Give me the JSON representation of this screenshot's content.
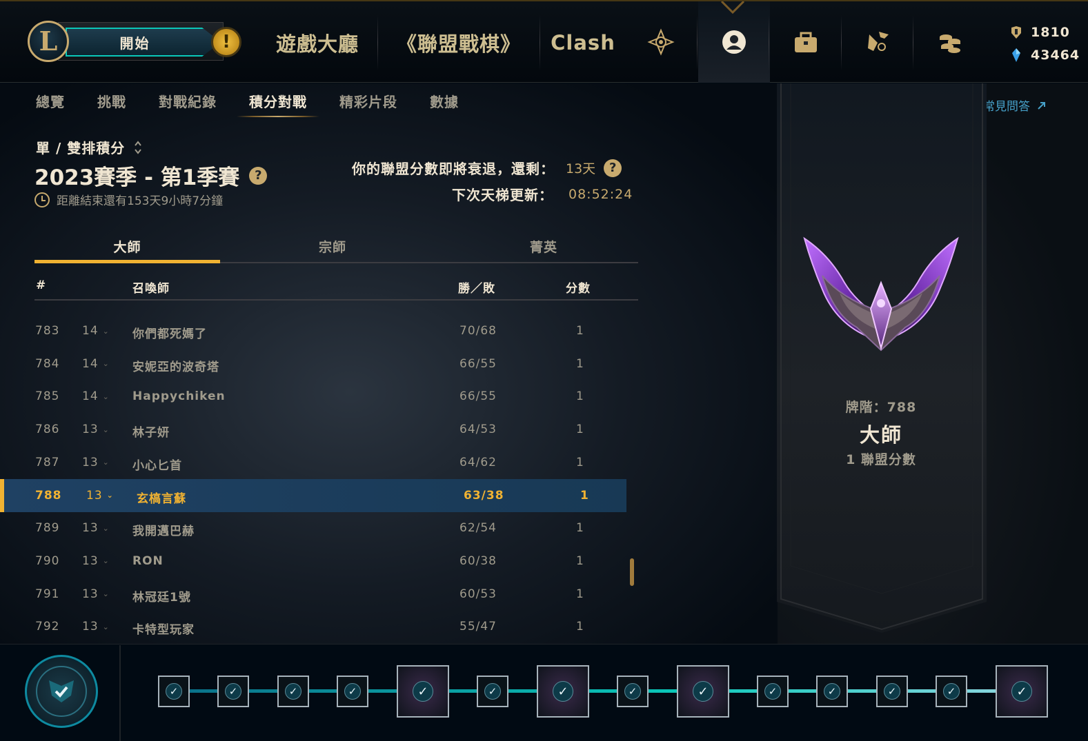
{
  "header": {
    "play_label": "開始",
    "nav_items": [
      "遊戲大廳",
      "《聯盟戰棋》",
      "Clash"
    ],
    "icons": [
      "trophy-icon",
      "profile-icon",
      "collection-icon",
      "loot-icon",
      "store-icon"
    ],
    "currency": {
      "rp": "1810",
      "be": "43464"
    }
  },
  "subnav": {
    "tabs": [
      "總覽",
      "挑戰",
      "對戰紀錄",
      "積分對戰",
      "精彩片段",
      "數據"
    ],
    "active": "積分對戰",
    "faq_link": "聯盟系統常見問答"
  },
  "ranked": {
    "queue": "單 / 雙排積分",
    "season_title": "2023賽季 - 第1季賽",
    "season_end": "距離結束還有153天9小時7分鐘",
    "decay_label": "你的聯盟分數即將衰退，還剩：",
    "decay_value": "13天",
    "ladder_label": "下次天梯更新：",
    "ladder_value": "08:52:24"
  },
  "tier_tabs": [
    "大師",
    "宗師",
    "菁英"
  ],
  "table": {
    "headers": {
      "rank": "#",
      "summoner": "召喚師",
      "winloss": "勝／敗",
      "points": "分數"
    },
    "rows": [
      {
        "rank": "783",
        "level": "14",
        "name": "你們都死媽了",
        "wl": "70/68",
        "lp": "1"
      },
      {
        "rank": "784",
        "level": "14",
        "name": "安妮亞的波奇塔",
        "wl": "66/55",
        "lp": "1"
      },
      {
        "rank": "785",
        "level": "14",
        "name": "Happychiken",
        "wl": "66/55",
        "lp": "1"
      },
      {
        "rank": "786",
        "level": "13",
        "name": "林子妍",
        "wl": "64/53",
        "lp": "1"
      },
      {
        "rank": "787",
        "level": "13",
        "name": "小心匕首",
        "wl": "64/62",
        "lp": "1"
      },
      {
        "rank": "788",
        "level": "13",
        "name": "玄槁言蘇",
        "wl": "63/38",
        "lp": "1"
      },
      {
        "rank": "789",
        "level": "13",
        "name": "我開邁巴赫",
        "wl": "62/54",
        "lp": "1"
      },
      {
        "rank": "790",
        "level": "13",
        "name": "RON",
        "wl": "60/38",
        "lp": "1"
      },
      {
        "rank": "791",
        "level": "13",
        "name": "林冠廷1號",
        "wl": "60/53",
        "lp": "1"
      },
      {
        "rank": "792",
        "level": "13",
        "name": "卡特型玩家",
        "wl": "55/47",
        "lp": "1"
      }
    ],
    "highlight_rank": "788"
  },
  "profile_rank": {
    "rank_label": "牌階：788",
    "tier": "大師",
    "lp": "1 聯盟分數"
  },
  "colors": {
    "gold": "#c8aa6e",
    "highlight": "#f0b232",
    "teal": "#0ac8b9",
    "master_purple": "#9b4fd6"
  }
}
